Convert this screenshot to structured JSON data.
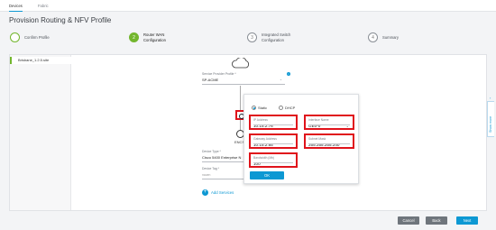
{
  "nav": {
    "tabs": [
      "Devices",
      "Fabric"
    ]
  },
  "page": {
    "title": "Provision Routing & NFV Profile"
  },
  "steps": [
    {
      "num": "",
      "line1": "Confirm Profile",
      "line2": ""
    },
    {
      "num": "2",
      "line1": "Router WAN",
      "line2": "Configuration"
    },
    {
      "num": "3",
      "line1": "Integrated Switch",
      "line2": "Configuration"
    },
    {
      "num": "4",
      "line1": "Summary",
      "line2": ""
    }
  ],
  "site": {
    "name": "Brisbane_1.2.5.site"
  },
  "provider": {
    "label": "Service Provider Profile *",
    "value": "SP-ACME"
  },
  "device": {
    "type_label": "Device Type *",
    "type_value": "Cisco 5400 Enterprise N",
    "tag_label": "Device Tag *",
    "tag_value": "nauen",
    "encs": "ENCS"
  },
  "popup": {
    "radio_static": "Static",
    "radio_dhcp": "DHCP",
    "ip_label": "IP Address",
    "ip_value": "10.15.2.76",
    "iface_label": "Interface Name",
    "iface_value": "GE0-0",
    "gw_label": "Gateway Address",
    "gw_value": "10.15.2.85",
    "mask_label": "Subnet Mask",
    "mask_value": "255.255.255.240",
    "bw_label": "Bandwidth (Mb)",
    "bw_value": "100",
    "ok_label": "OK"
  },
  "actions": {
    "add_services": "Add Services",
    "cancel": "Cancel",
    "back": "Back",
    "next": "Next"
  },
  "side": {
    "label": "Show more"
  },
  "colors": {
    "accent": "#0d98d3",
    "step_green": "#73b62e",
    "highlight": "#e0131b"
  }
}
